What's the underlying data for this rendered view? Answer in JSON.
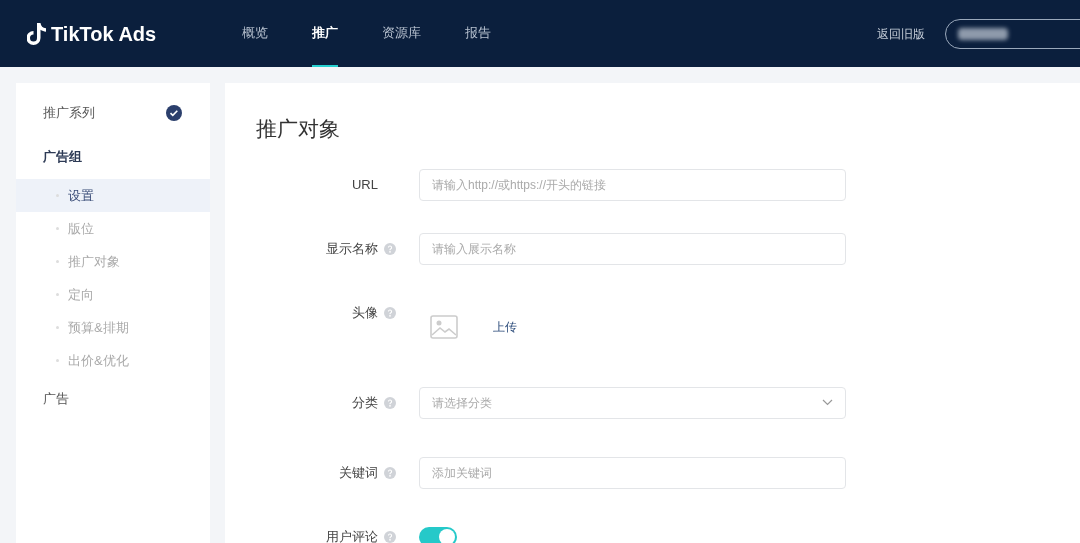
{
  "header": {
    "logo": "TikTok Ads",
    "nav": [
      {
        "label": "概览",
        "selected": false
      },
      {
        "label": "推广",
        "selected": true
      },
      {
        "label": "资源库",
        "selected": false
      },
      {
        "label": "报告",
        "selected": false
      }
    ],
    "back_link": "返回旧版"
  },
  "sidebar": {
    "items": [
      {
        "kind": "section",
        "label": "推广系列",
        "checked": true,
        "active": false
      },
      {
        "kind": "section",
        "label": "广告组",
        "checked": false,
        "active": true
      },
      {
        "kind": "step",
        "label": "设置",
        "selected": true
      },
      {
        "kind": "step",
        "label": "版位",
        "selected": false
      },
      {
        "kind": "step",
        "label": "推广对象",
        "selected": false
      },
      {
        "kind": "step",
        "label": "定向",
        "selected": false
      },
      {
        "kind": "step",
        "label": "预算&排期",
        "selected": false
      },
      {
        "kind": "step",
        "label": "出价&优化",
        "selected": false
      },
      {
        "kind": "section",
        "label": "广告",
        "checked": false,
        "active": false
      }
    ]
  },
  "form": {
    "title": "推广对象",
    "fields": [
      {
        "kind": "input",
        "label": "URL",
        "help": false,
        "placeholder": "请输入http://或https://开头的链接"
      },
      {
        "kind": "input",
        "label": "显示名称",
        "help": true,
        "placeholder": "请输入展示名称"
      },
      {
        "kind": "upload",
        "label": "头像",
        "help": true,
        "action": "上传"
      },
      {
        "kind": "select",
        "label": "分类",
        "help": true,
        "placeholder": "请选择分类"
      },
      {
        "kind": "input",
        "label": "关键词",
        "help": true,
        "placeholder": "添加关键词"
      },
      {
        "kind": "toggle",
        "label": "用户评论",
        "help": true,
        "on": true
      }
    ]
  }
}
